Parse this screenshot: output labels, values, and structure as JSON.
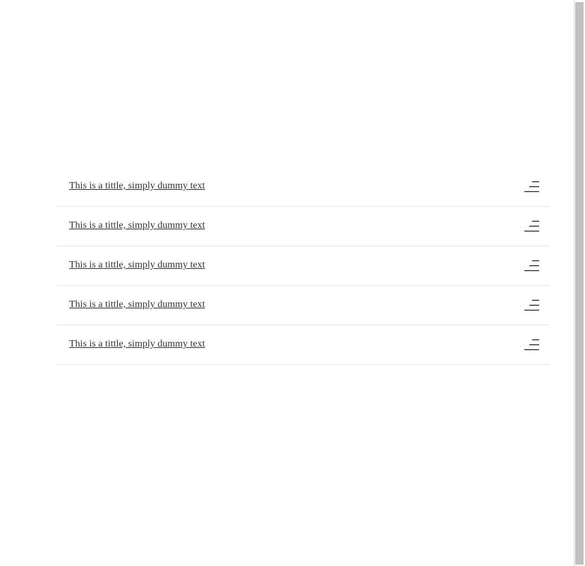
{
  "list": {
    "items": [
      {
        "title": "This is a tittle, simply dummy text",
        "icon": "menu-icon"
      },
      {
        "title": "This is a tittle, simply dummy text",
        "icon": "menu-icon"
      },
      {
        "title": "This is a tittle, simply dummy text",
        "icon": "menu-icon"
      },
      {
        "title": "This is a tittle, simply dummy text",
        "icon": "menu-icon"
      },
      {
        "title": "This is a tittle, simply dummy text",
        "icon": "menu-icon"
      }
    ]
  },
  "colors": {
    "text": "#333333",
    "divider": "#e9e9e9",
    "scrollbar_thumb": "#c1c1c1",
    "background": "#ffffff"
  }
}
